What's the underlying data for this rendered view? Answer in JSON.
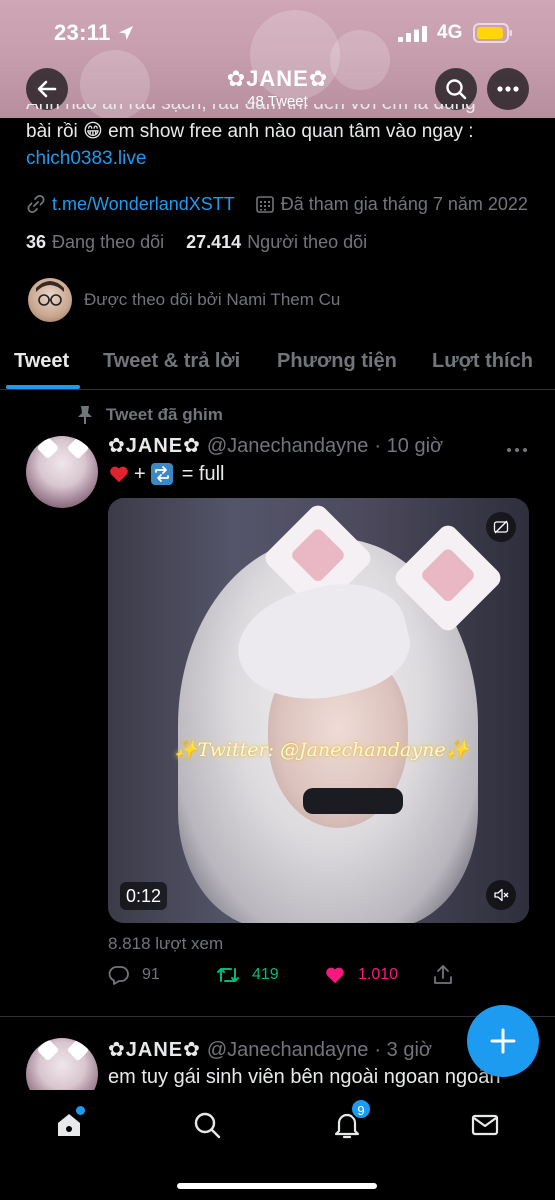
{
  "status_bar": {
    "time": "23:11",
    "network": "4G"
  },
  "header": {
    "title": "✿JANE✿",
    "subtitle": "48 Tweet"
  },
  "profile": {
    "bio_clipped": "Anh nào ăn rau sạch, rau dâm thì đến với em là đúng",
    "bio_line2": "bài rồi 😁 em show free anh nào quan tâm vào ngay :",
    "bio_link": "chich0383.live",
    "website": "t.me/WonderlandXSTT",
    "joined": "Đã tham gia tháng 7 năm 2022",
    "following_count": "36",
    "following_label": "Đang theo dõi",
    "followers_count": "27.414",
    "followers_label": "Người theo dõi",
    "followed_by": "Được theo dõi bởi Nami Them Cu"
  },
  "tabs": [
    {
      "label": "Tweet",
      "active": true
    },
    {
      "label": "Tweet & trả lời"
    },
    {
      "label": "Phương tiện"
    },
    {
      "label": "Lượt thích"
    }
  ],
  "tweet1": {
    "pinned_label": "Tweet đã ghim",
    "name": "✿JANE✿",
    "handle": "@Janechandayne",
    "time": "· 10 giờ",
    "text_suffix": "= full",
    "media": {
      "watermark": "✨Twitter: @Janechandayne✨",
      "duration": "0:12"
    },
    "views": "8.818 lượt xem",
    "replies": "91",
    "retweets": "419",
    "likes": "1.010"
  },
  "tweet2": {
    "name": "✿JANE✿",
    "handle": "@Janechandayne",
    "time": "· 3 giờ",
    "text": "em tuy gái sinh viên bên ngoài ngoan ngoãn"
  },
  "bottom_nav": {
    "notification_count": "9",
    "icons": [
      "home-icon",
      "search-icon",
      "bell-icon",
      "mail-icon"
    ]
  },
  "colors": {
    "accent": "#1d9bf0",
    "retweet": "#00ba7c",
    "like": "#f91880",
    "muted": "#71767b"
  }
}
